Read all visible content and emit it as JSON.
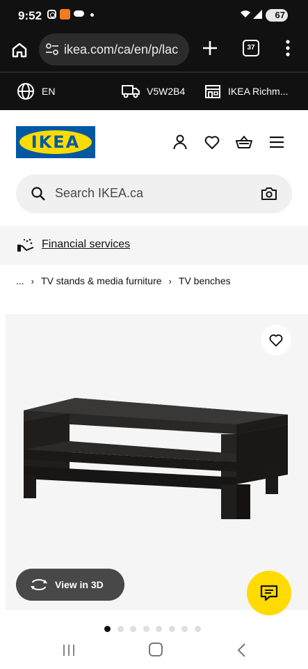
{
  "status_bar": {
    "time": "9:52",
    "battery": "67",
    "icons": [
      "instagram-icon",
      "app-notification-icon",
      "cloud-icon",
      "notification-dot-icon",
      "wifi-icon",
      "signal-icon",
      "battery-icon"
    ]
  },
  "browser": {
    "url": "ikea.com/ca/en/p/lac",
    "tab_count": "37",
    "icons": [
      "home-icon",
      "site-settings-icon",
      "new-tab-plus-icon",
      "tabs-icon",
      "more-menu-icon"
    ]
  },
  "top_strip": {
    "language": "EN",
    "postal_code": "V5W2B4",
    "store": "IKEA Richm..."
  },
  "header": {
    "logo_text": "IKEA",
    "icons": [
      "user-icon",
      "heart-icon",
      "basket-icon",
      "hamburger-menu-icon"
    ]
  },
  "search": {
    "placeholder": "Search IKEA.ca"
  },
  "banner": {
    "financial_label": "Financial services"
  },
  "breadcrumb": {
    "items": [
      "...",
      "TV stands & media furniture",
      "TV benches"
    ]
  },
  "product": {
    "view_3d_label": "View in 3D",
    "image_count": 8,
    "active_image": 1
  },
  "colors": {
    "ikea_blue": "#0058a3",
    "ikea_yellow": "#ffdb00",
    "dark": "#111111",
    "pill_gray": "#484848"
  }
}
